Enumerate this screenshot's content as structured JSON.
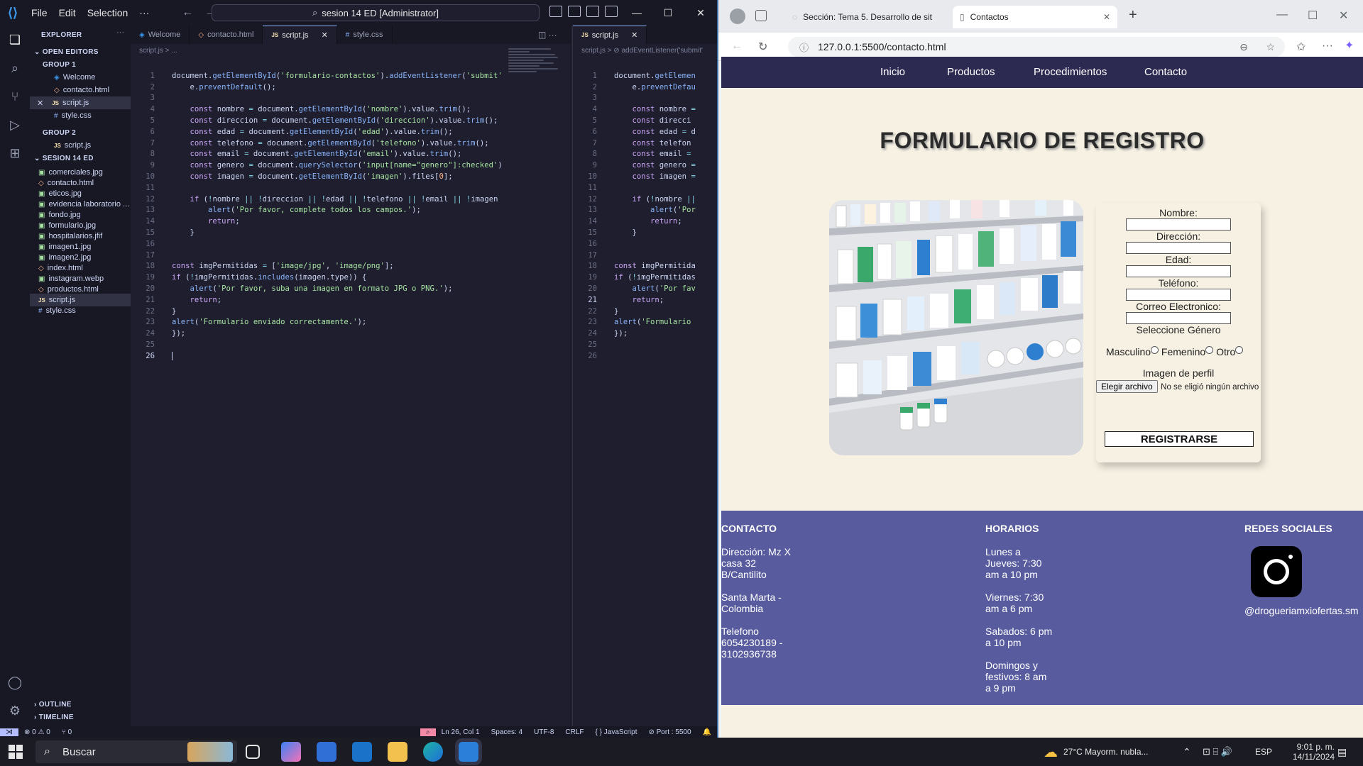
{
  "vscode": {
    "menu": [
      "File",
      "Edit",
      "Selection",
      "···"
    ],
    "search": "sesion 14 ED [Administrator]",
    "explorer_title": "EXPLORER",
    "open_editors": "OPEN EDITORS",
    "group1": "GROUP 1",
    "group1_files": [
      "Welcome",
      "contacto.html",
      "script.js",
      "style.css"
    ],
    "group2": "GROUP 2",
    "group2_files": [
      "script.js"
    ],
    "folder": "SESION 14 ED",
    "files": [
      "comerciales.jpg",
      "contacto.html",
      "eticos.jpg",
      "evidencia laboratorio ...",
      "fondo.jpg",
      "formulario.jpg",
      "hospitalarios.jfif",
      "imagen1.jpg",
      "imagen2.jpg",
      "index.html",
      "instagram.webp",
      "productos.html",
      "script.js",
      "style.css"
    ],
    "outline": "OUTLINE",
    "timeline": "TIMELINE",
    "tabs1": [
      "Welcome",
      "contacto.html",
      "script.js",
      "style.css"
    ],
    "tabs2": [
      "script.js"
    ],
    "breadcrumb1": "script.js > ...",
    "breadcrumb2": "script.js > ⊘ addEventListener('submit'",
    "status": {
      "errors": "⊗ 0 ⚠ 0",
      "ports": "⑂ 0",
      "position": "Ln 26, Col 1",
      "spaces": "Spaces: 4",
      "encoding": "UTF-8",
      "eol": "CRLF",
      "language": "{ } JavaScript",
      "port": "⊘ Port : 5500"
    },
    "line_numbers": [
      "1",
      "2",
      "3",
      "4",
      "5",
      "6",
      "7",
      "8",
      "9",
      "10",
      "11",
      "12",
      "13",
      "14",
      "15",
      "16",
      "17",
      "18",
      "19",
      "20",
      "21",
      "22",
      "23",
      "24",
      "25",
      "26"
    ]
  },
  "browser": {
    "tab1": "Sección: Tema 5. Desarrollo de sit",
    "tab2": "Contactos",
    "url": "127.0.0.1:5500/contacto.html",
    "nav": [
      "Inicio",
      "Productos",
      "Procedimientos",
      "Contacto"
    ],
    "title": "FORMULARIO DE REGISTRO",
    "form": {
      "nombre": "Nombre:",
      "direccion": "Dirección:",
      "edad": "Edad:",
      "telefono": "Teléfono:",
      "correo": "Correo Electronico:",
      "genero": "Seleccione Género",
      "masculino": "Masculino",
      "femenino": "Femenino",
      "otro": "Otro",
      "imagen": "Imagen de perfil",
      "file_button": "Elegir archivo",
      "file_status": "No se eligió ningún archivo",
      "submit": "REGISTRARSE"
    },
    "footer": {
      "contacto_h": "CONTACTO",
      "contacto": [
        "Dirección: Mz X casa 32 B/Cantilito",
        "Santa Marta - Colombia",
        "Telefono 6054230189 - 3102936738"
      ],
      "horarios_h": "HORARIOS",
      "horarios": [
        "Lunes a Jueves: 7:30 am a 10 pm",
        "Viernes: 7:30 am a 6 pm",
        "Sabados: 6 pm a 10 pm",
        "Domingos y festivos: 8 am a 9 pm"
      ],
      "redes_h": "REDES SOCIALES",
      "handle": "@drogueriamxiofertas.sm"
    }
  },
  "taskbar": {
    "search": "Buscar",
    "weather": "27°C  Mayorm. nubla...",
    "lang": "ESP",
    "time": "9:01 p. m.",
    "date": "14/11/2024"
  }
}
